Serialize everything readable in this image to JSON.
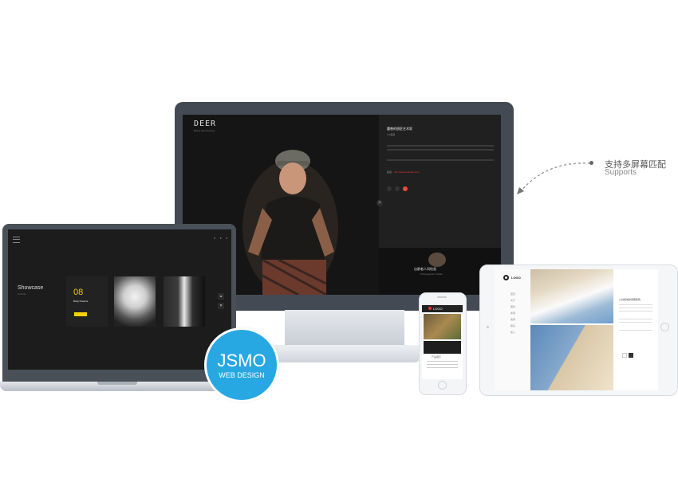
{
  "badge": {
    "main": "JSMO",
    "sub": "WEB DESIGN",
    "color": "#27a8e3"
  },
  "annotation": {
    "line1": "支持多屏幕匹配",
    "line2": "Supports"
  },
  "desktop": {
    "logo": "DEER",
    "logo_sub": "Brand and dressing",
    "title": "魔兽的朋匠艺术家",
    "meta": "3.0美国",
    "link_label": "链接：",
    "link_url": "http://www.website.com",
    "caption": "自爵者人间绘画",
    "caption_sub": "Photographer Visible",
    "close_glyph": "✕"
  },
  "laptop": {
    "showcase": "Showcase",
    "showcase_sub": "Portfolio",
    "card_number": "08",
    "card_text": "Body Dreams"
  },
  "phone": {
    "logo": "LOGO",
    "label": "产品展示"
  },
  "tablet": {
    "logo": "LOGO",
    "nav": [
      "首页",
      "关于",
      "服务",
      "新闻",
      "案例",
      "联系",
      "加入"
    ],
    "title": "公共和城市家居建筑"
  }
}
